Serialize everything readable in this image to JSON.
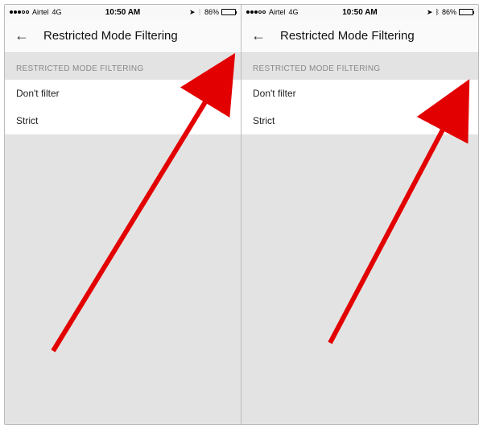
{
  "screens": [
    {
      "status": {
        "carrier": "Airtel",
        "network": "4G",
        "time": "10:50 AM",
        "battery_pct": "86%",
        "bluetooth_active": false
      },
      "header": {
        "title": "Restricted Mode Filtering"
      },
      "section_label": "RESTRICTED MODE FILTERING",
      "options": [
        {
          "label": "Don't filter",
          "selected": true
        },
        {
          "label": "Strict",
          "selected": false
        }
      ]
    },
    {
      "status": {
        "carrier": "Airtel",
        "network": "4G",
        "time": "10:50 AM",
        "battery_pct": "86%",
        "bluetooth_active": true
      },
      "header": {
        "title": "Restricted Mode Filtering"
      },
      "section_label": "RESTRICTED MODE FILTERING",
      "options": [
        {
          "label": "Don't filter",
          "selected": false
        },
        {
          "label": "Strict",
          "selected": true
        }
      ]
    }
  ]
}
